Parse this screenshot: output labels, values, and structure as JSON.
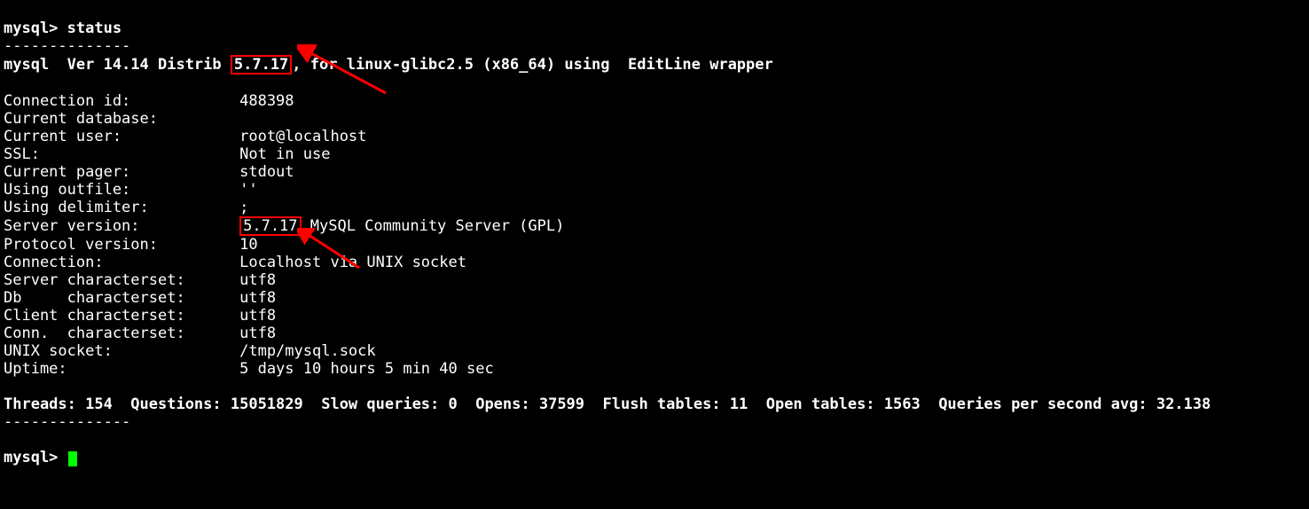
{
  "prompt1_prefix": "mysql> ",
  "command": "status",
  "dashes_top": "--------------",
  "version_line_before": "mysql  Ver 14.14 Distrib ",
  "version_boxed_1": "5.7.17",
  "version_line_after": ", for linux-glibc2.5 (x86_64) using  EditLine wrapper",
  "rows": {
    "connection_id": {
      "label": "Connection id:",
      "value": "488398"
    },
    "current_database": {
      "label": "Current database:",
      "value": ""
    },
    "current_user": {
      "label": "Current user:",
      "value": "root@localhost"
    },
    "ssl": {
      "label": "SSL:",
      "value": "Not in use"
    },
    "current_pager": {
      "label": "Current pager:",
      "value": "stdout"
    },
    "using_outfile": {
      "label": "Using outfile:",
      "value": "''"
    },
    "using_delimiter": {
      "label": "Using delimiter:",
      "value": ";"
    },
    "server_version": {
      "label": "Server version:",
      "value_boxed": "5.7.17",
      "value_after": " MySQL Community Server (GPL)"
    },
    "protocol_version": {
      "label": "Protocol version:",
      "value": "10"
    },
    "connection": {
      "label": "Connection:",
      "value": "Localhost via UNIX socket"
    },
    "server_charset": {
      "label": "Server characterset:",
      "value": "utf8"
    },
    "db_charset": {
      "label": "Db     characterset:",
      "value": "utf8"
    },
    "client_charset": {
      "label": "Client characterset:",
      "value": "utf8"
    },
    "conn_charset": {
      "label": "Conn.  characterset:",
      "value": "utf8"
    },
    "unix_socket": {
      "label": "UNIX socket:",
      "value": "/tmp/mysql.sock"
    },
    "uptime": {
      "label": "Uptime:",
      "value": "5 days 10 hours 5 min 40 sec"
    }
  },
  "stats_line": "Threads: 154  Questions: 15051829  Slow queries: 0  Opens: 37599  Flush tables: 11  Open tables: 1563  Queries per second avg: 32.138",
  "dashes_bottom": "--------------",
  "prompt2_prefix": "mysql> ",
  "label_col_width": 26
}
